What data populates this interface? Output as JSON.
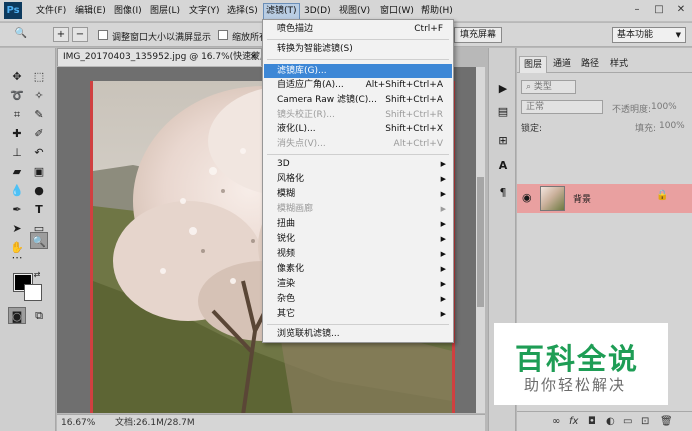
{
  "app": {
    "logo": "Ps"
  },
  "menubar": {
    "items": [
      "文件(F)",
      "编辑(E)",
      "图像(I)",
      "图层(L)",
      "文字(Y)",
      "选择(S)",
      "滤镜(T)",
      "3D(D)",
      "视图(V)",
      "窗口(W)",
      "帮助(H)"
    ],
    "active": "滤镜(T)",
    "window_controls": [
      "–",
      "□",
      "✕"
    ]
  },
  "options": {
    "resize_windows_label": "调整窗口大小以满屏显示",
    "zoom_all_label": "缩放所有",
    "fill_screen_button": "填充屏幕",
    "workspace": "基本功能"
  },
  "document": {
    "tab_title": "IMG_20170403_135952.jpg @ 16.7%(快速蒙版/8) *",
    "tab_close": "×",
    "zoom": "16.67%",
    "doc_size": "文档:26.1M/28.7M"
  },
  "filter_menu": {
    "items": [
      {
        "label": "喷色描边",
        "shortcut": "Ctrl+F",
        "state": "normal"
      },
      {
        "label": "转换为智能滤镜(S)",
        "shortcut": "",
        "state": "normal"
      },
      {
        "label": "滤镜库(G)...",
        "shortcut": "",
        "state": "highlighted"
      },
      {
        "label": "自适应广角(A)...",
        "shortcut": "Alt+Shift+Ctrl+A",
        "state": "normal"
      },
      {
        "label": "Camera Raw 滤镜(C)...",
        "shortcut": "Shift+Ctrl+A",
        "state": "normal"
      },
      {
        "label": "镜头校正(R)...",
        "shortcut": "Shift+Ctrl+R",
        "state": "disabled"
      },
      {
        "label": "液化(L)...",
        "shortcut": "Shift+Ctrl+X",
        "state": "normal"
      },
      {
        "label": "消失点(V)...",
        "shortcut": "Alt+Ctrl+V",
        "state": "disabled"
      },
      {
        "label": "3D",
        "submenu": true,
        "state": "normal"
      },
      {
        "label": "风格化",
        "submenu": true,
        "state": "normal"
      },
      {
        "label": "模糊",
        "submenu": true,
        "state": "normal"
      },
      {
        "label": "模糊画廊",
        "submenu": true,
        "state": "disabled"
      },
      {
        "label": "扭曲",
        "submenu": true,
        "state": "normal"
      },
      {
        "label": "锐化",
        "submenu": true,
        "state": "normal"
      },
      {
        "label": "视频",
        "submenu": true,
        "state": "normal"
      },
      {
        "label": "像素化",
        "submenu": true,
        "state": "normal"
      },
      {
        "label": "渲染",
        "submenu": true,
        "state": "normal"
      },
      {
        "label": "杂色",
        "submenu": true,
        "state": "normal"
      },
      {
        "label": "其它",
        "submenu": true,
        "state": "normal"
      },
      {
        "label": "浏览联机滤镜...",
        "shortcut": "",
        "state": "normal"
      }
    ]
  },
  "layers_panel": {
    "tabs": [
      "图层",
      "通道",
      "路径",
      "样式"
    ],
    "filter_kind": "类型",
    "blend_mode": "正常",
    "opacity_label": "不透明度:",
    "opacity_value": "100%",
    "lock_label": "锁定:",
    "fill_label": "填充:",
    "fill_value": "100%",
    "layer_name": "背景",
    "footer_icons": [
      "link-icon",
      "fx-icon",
      "mask-icon",
      "adjustment-icon",
      "group-icon",
      "new-layer-icon",
      "trash-icon"
    ]
  },
  "watermark": {
    "title": "百科全说",
    "subtitle": "助你轻松解决"
  },
  "colors": {
    "menu_highlight": "#3d87d6",
    "layer_selected": "#e9a0a0",
    "quick_mask_border": "#d04040",
    "watermark_green": "#1e9d55"
  }
}
